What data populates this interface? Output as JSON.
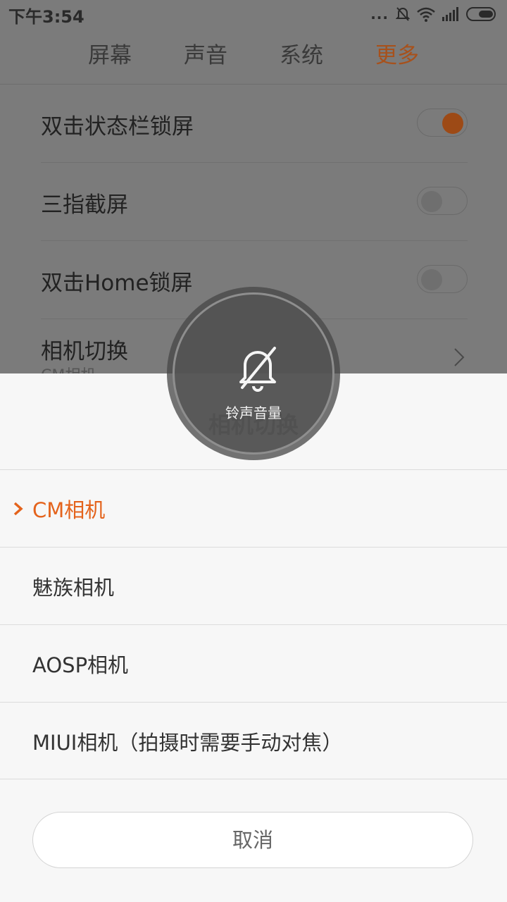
{
  "statusbar": {
    "time": "下午3:54",
    "dots": "...",
    "battery": "battery-icon"
  },
  "tabs": [
    {
      "label": "屏幕",
      "active": false
    },
    {
      "label": "声音",
      "active": false
    },
    {
      "label": "系统",
      "active": false
    },
    {
      "label": "更多",
      "active": true
    }
  ],
  "settings": [
    {
      "label": "双击状态栏锁屏",
      "toggle": true
    },
    {
      "label": "三指截屏",
      "toggle": false
    },
    {
      "label": "双击Home锁屏",
      "toggle": false
    },
    {
      "label": "相机切换",
      "sublabel": "CM相机"
    }
  ],
  "sheet": {
    "title": "相机切换",
    "options": [
      {
        "label": "CM相机",
        "selected": true
      },
      {
        "label": "魅族相机",
        "selected": false
      },
      {
        "label": "AOSP相机",
        "selected": false
      },
      {
        "label": "MIUI相机（拍摄时需要手动对焦）",
        "selected": false
      }
    ],
    "cancel_label": "取消"
  },
  "volume_overlay": {
    "label": "铃声音量",
    "icon": "bell-off-icon"
  },
  "colors": {
    "accent": "#e4631c",
    "dim_accent": "#a7511c",
    "sheet_bg": "#f7f7f7",
    "scrim": "#7b7b7b"
  }
}
